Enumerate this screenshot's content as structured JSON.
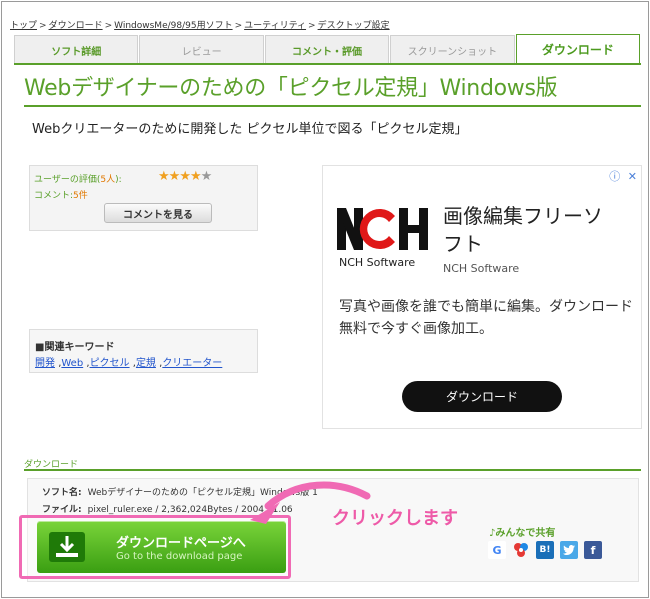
{
  "breadcrumb": [
    "トップ",
    "ダウンロード",
    "WindowsMe/98/95用ソフト",
    "ユーティリティ",
    "デスクトップ設定"
  ],
  "tabs": [
    {
      "label": "ソフト詳細"
    },
    {
      "label": "レビュー"
    },
    {
      "label": "コメント・評価"
    },
    {
      "label": "スクリーンショット"
    },
    {
      "label": "ダウンロード"
    }
  ],
  "page": {
    "title": "Webデザイナーのための「ピクセル定規」Windows版",
    "subtitle": "Webクリエーターのために開発した ピクセル単位で図る「ピクセル定規」"
  },
  "rating": {
    "label_prefix": "ユーザーの評価(",
    "count": "5人",
    "label_suffix": "):",
    "stars_filled": 4,
    "stars_total": 5,
    "comment_prefix": "コメント:",
    "comment_count": "5件",
    "button": "コメントを見る"
  },
  "keywords": {
    "title": "■関連キーワード",
    "items": [
      "開発",
      "Web",
      "ピクセル",
      "定規",
      "クリエーター"
    ]
  },
  "ad": {
    "info_icon": "ⓘ",
    "close_icon": "✕",
    "logo_caption": "NCH Software",
    "headline": "画像編集フリーソフト",
    "brand": "NCH Software",
    "body": "写真や画像を誰でも簡単に編集。ダウンロード無料で今すぐ画像加工。",
    "cta": "ダウンロード"
  },
  "download": {
    "section_label": "ダウンロード",
    "name_label": "ソフト名:",
    "name_value": "Webデザイナーのための「ピクセル定規」Windows版 1",
    "file_label": "ファイル:",
    "file_value": "pixel_ruler.exe / 2,362,024Bytes / 2004.01.06",
    "button_main": "ダウンロードページへ",
    "button_sub": "Go to the download page"
  },
  "annotation": {
    "click_text": "クリックします",
    "highlight_color": "#f06ab4"
  },
  "share": {
    "title": "♪みんなで共有",
    "icons": [
      "google-icon",
      "gree-icon",
      "hatena-bookmark-icon",
      "twitter-icon",
      "facebook-icon"
    ]
  },
  "colors": {
    "accent_green": "#5aa02a",
    "link_blue": "#2255cc",
    "star": "#f0a020"
  }
}
